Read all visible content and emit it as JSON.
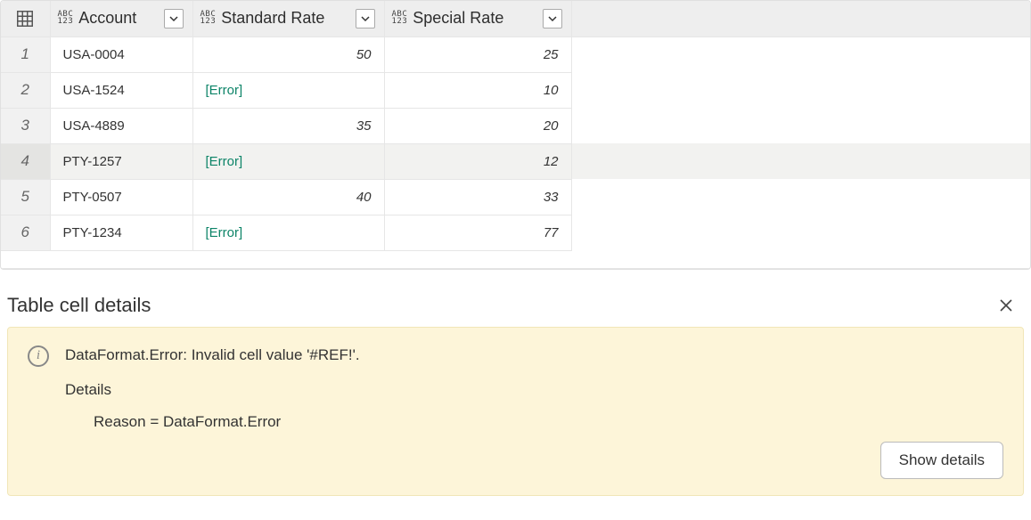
{
  "table": {
    "columns": [
      {
        "label": "Account"
      },
      {
        "label": "Standard Rate"
      },
      {
        "label": "Special Rate"
      }
    ],
    "rows": [
      {
        "idx": "1",
        "account": "USA-0004",
        "std": "50",
        "std_err": false,
        "spc": "25",
        "selected": false
      },
      {
        "idx": "2",
        "account": "USA-1524",
        "std": "[Error]",
        "std_err": true,
        "spc": "10",
        "selected": false
      },
      {
        "idx": "3",
        "account": "USA-4889",
        "std": "35",
        "std_err": false,
        "spc": "20",
        "selected": false
      },
      {
        "idx": "4",
        "account": "PTY-1257",
        "std": "[Error]",
        "std_err": true,
        "spc": "12",
        "selected": true
      },
      {
        "idx": "5",
        "account": "PTY-0507",
        "std": "40",
        "std_err": false,
        "spc": "33",
        "selected": false
      },
      {
        "idx": "6",
        "account": "PTY-1234",
        "std": "[Error]",
        "std_err": true,
        "spc": "77",
        "selected": false
      }
    ]
  },
  "details": {
    "title": "Table cell details",
    "message": "DataFormat.Error: Invalid cell value '#REF!'.",
    "details_label": "Details",
    "reason_line": "Reason = DataFormat.Error",
    "show_details_label": "Show details"
  }
}
